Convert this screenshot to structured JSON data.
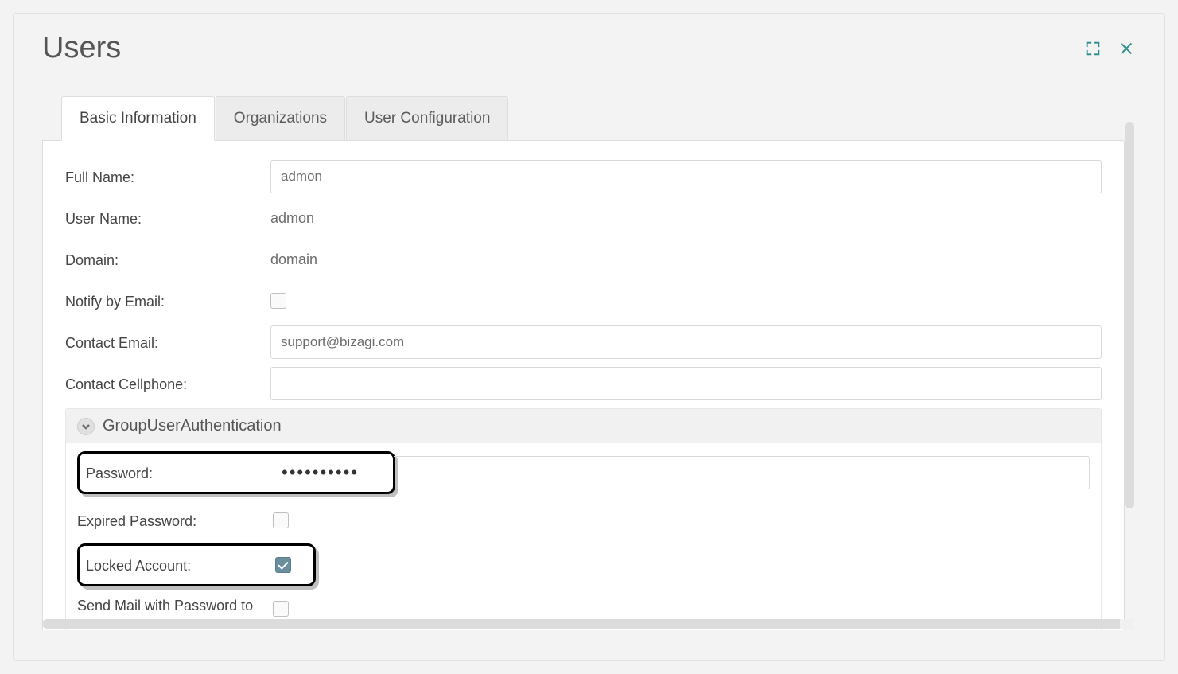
{
  "header": {
    "title": "Users"
  },
  "tabs": [
    {
      "label": "Basic Information",
      "active": true
    },
    {
      "label": "Organizations",
      "active": false
    },
    {
      "label": "User Configuration",
      "active": false
    }
  ],
  "form": {
    "full_name_label": "Full Name:",
    "full_name_value": "admon",
    "user_name_label": "User Name:",
    "user_name_value": "admon",
    "domain_label": "Domain:",
    "domain_value": "domain",
    "notify_email_label": "Notify by Email:",
    "notify_email_checked": false,
    "contact_email_label": "Contact Email:",
    "contact_email_value": "support@bizagi.com",
    "contact_cell_label": "Contact Cellphone:",
    "contact_cell_value": ""
  },
  "group": {
    "title": "GroupUserAuthentication",
    "password_label": "Password:",
    "password_mask": "••••••••••",
    "expired_label": "Expired Password:",
    "expired_checked": false,
    "locked_label": "Locked Account:",
    "locked_checked": true,
    "sendmail_label": "Send Mail with Password to User:",
    "sendmail_checked": false
  }
}
